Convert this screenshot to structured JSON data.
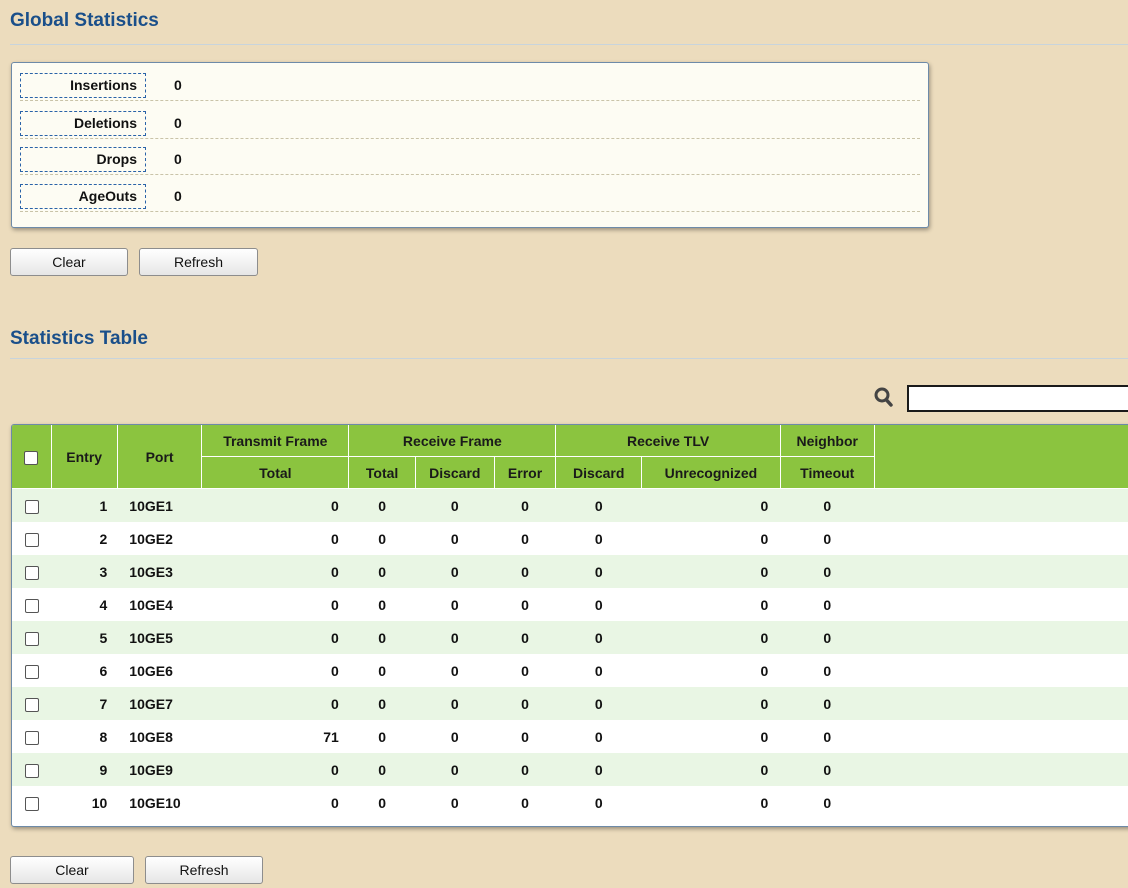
{
  "global": {
    "title": "Global Statistics",
    "rows": [
      {
        "label": "Insertions",
        "value": "0"
      },
      {
        "label": "Deletions",
        "value": "0"
      },
      {
        "label": "Drops",
        "value": "0"
      },
      {
        "label": "AgeOuts",
        "value": "0"
      }
    ],
    "clear_label": "Clear",
    "refresh_label": "Refresh"
  },
  "stats": {
    "title": "Statistics Table",
    "search": {
      "placeholder": "",
      "value": ""
    },
    "headers": {
      "entry": "Entry",
      "port": "Port",
      "transmit_frame": "Transmit Frame",
      "transmit_total": "Total",
      "receive_frame": "Receive Frame",
      "receive_total": "Total",
      "receive_discard": "Discard",
      "receive_error": "Error",
      "receive_tlv": "Receive TLV",
      "tlv_discard": "Discard",
      "tlv_unrecognized": "Unrecognized",
      "neighbor": "Neighbor",
      "timeout": "Timeout"
    },
    "rows": [
      {
        "entry": "1",
        "port": "10GE1",
        "tx_total": "0",
        "rx_total": "0",
        "rx_discard": "0",
        "rx_error": "0",
        "tlv_discard": "0",
        "tlv_unrecognized": "0",
        "timeout": "0"
      },
      {
        "entry": "2",
        "port": "10GE2",
        "tx_total": "0",
        "rx_total": "0",
        "rx_discard": "0",
        "rx_error": "0",
        "tlv_discard": "0",
        "tlv_unrecognized": "0",
        "timeout": "0"
      },
      {
        "entry": "3",
        "port": "10GE3",
        "tx_total": "0",
        "rx_total": "0",
        "rx_discard": "0",
        "rx_error": "0",
        "tlv_discard": "0",
        "tlv_unrecognized": "0",
        "timeout": "0"
      },
      {
        "entry": "4",
        "port": "10GE4",
        "tx_total": "0",
        "rx_total": "0",
        "rx_discard": "0",
        "rx_error": "0",
        "tlv_discard": "0",
        "tlv_unrecognized": "0",
        "timeout": "0"
      },
      {
        "entry": "5",
        "port": "10GE5",
        "tx_total": "0",
        "rx_total": "0",
        "rx_discard": "0",
        "rx_error": "0",
        "tlv_discard": "0",
        "tlv_unrecognized": "0",
        "timeout": "0"
      },
      {
        "entry": "6",
        "port": "10GE6",
        "tx_total": "0",
        "rx_total": "0",
        "rx_discard": "0",
        "rx_error": "0",
        "tlv_discard": "0",
        "tlv_unrecognized": "0",
        "timeout": "0"
      },
      {
        "entry": "7",
        "port": "10GE7",
        "tx_total": "0",
        "rx_total": "0",
        "rx_discard": "0",
        "rx_error": "0",
        "tlv_discard": "0",
        "tlv_unrecognized": "0",
        "timeout": "0"
      },
      {
        "entry": "8",
        "port": "10GE8",
        "tx_total": "71",
        "rx_total": "0",
        "rx_discard": "0",
        "rx_error": "0",
        "tlv_discard": "0",
        "tlv_unrecognized": "0",
        "timeout": "0"
      },
      {
        "entry": "9",
        "port": "10GE9",
        "tx_total": "0",
        "rx_total": "0",
        "rx_discard": "0",
        "rx_error": "0",
        "tlv_discard": "0",
        "tlv_unrecognized": "0",
        "timeout": "0"
      },
      {
        "entry": "10",
        "port": "10GE10",
        "tx_total": "0",
        "rx_total": "0",
        "rx_discard": "0",
        "rx_error": "0",
        "tlv_discard": "0",
        "tlv_unrecognized": "0",
        "timeout": "0"
      }
    ],
    "clear_label": "Clear",
    "refresh_label": "Refresh"
  },
  "colors": {
    "background": "#ecdcbd",
    "title": "#1a4f8a",
    "header_green": "#8bc43f",
    "row_alt": "#e9f6e4"
  }
}
